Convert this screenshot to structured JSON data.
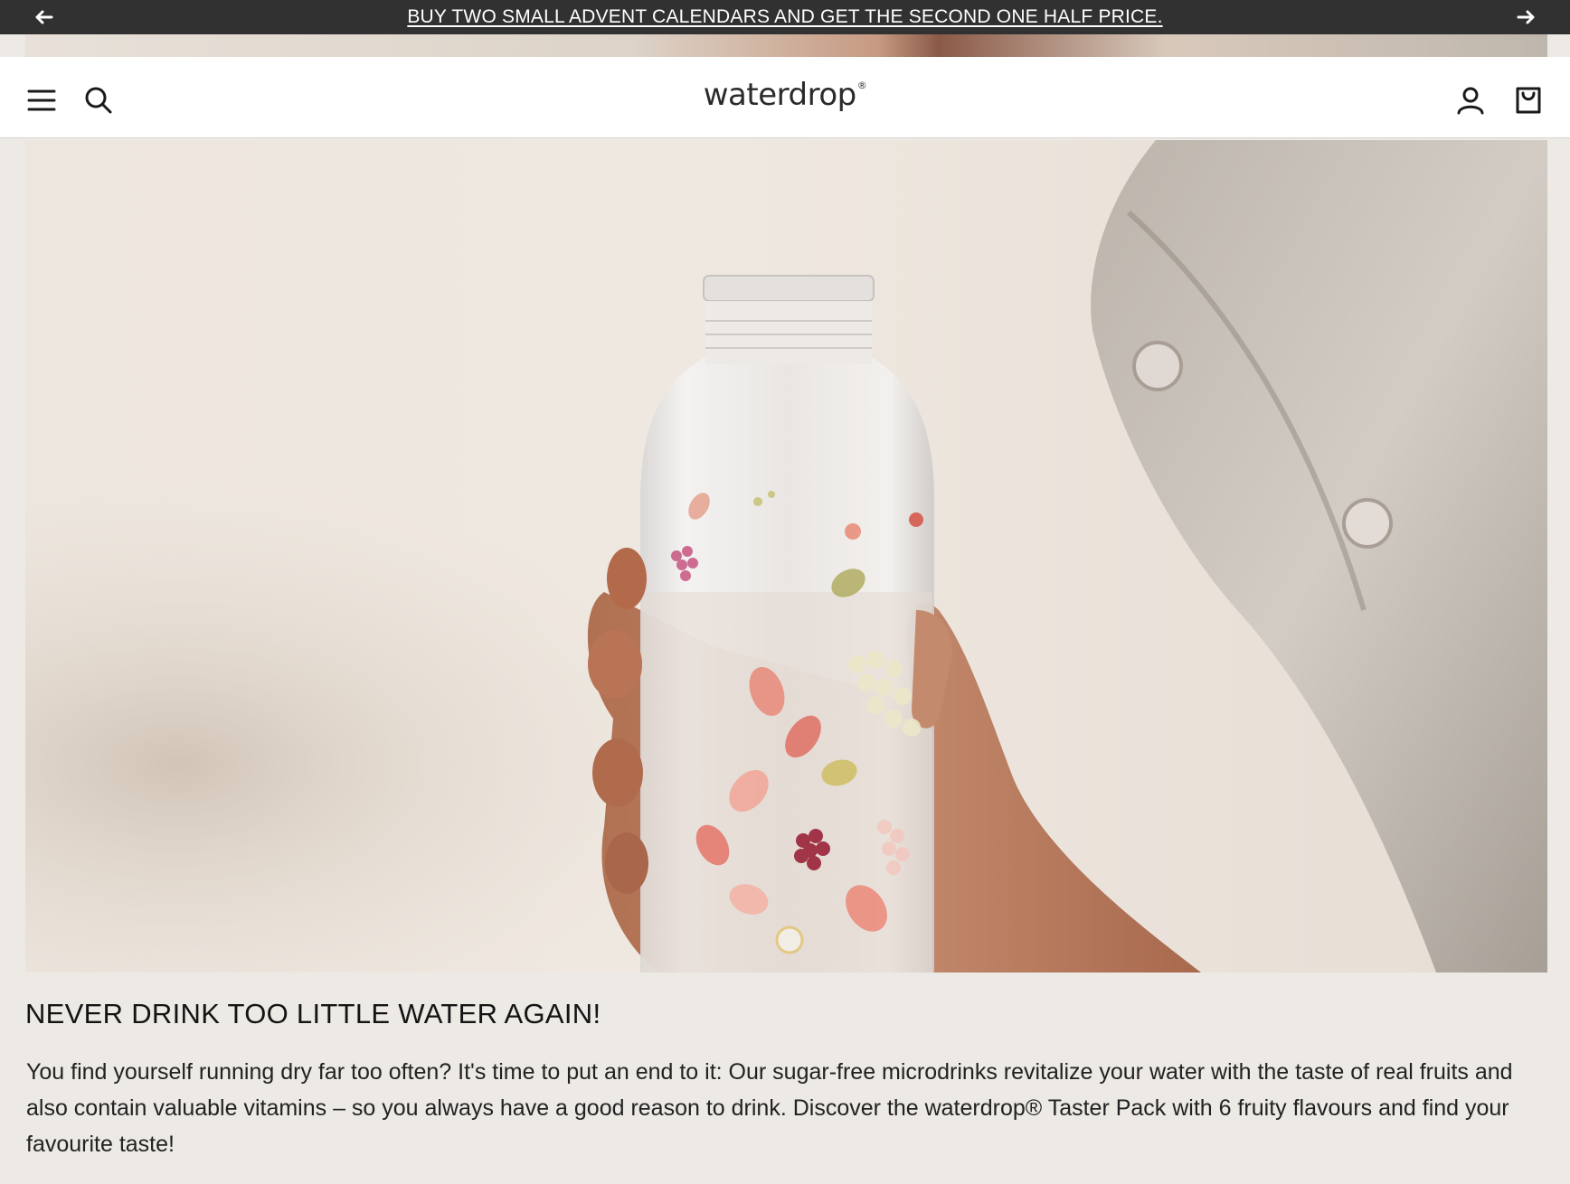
{
  "announcement": {
    "text": "BUY TWO SMALL ADVENT CALENDARS AND GET THE SECOND ONE HALF PRICE.",
    "prev_icon": "arrow-left-icon",
    "next_icon": "arrow-right-icon"
  },
  "header": {
    "logo_text": "waterdrop",
    "logo_mark": "®",
    "icons": [
      "menu-icon",
      "search-icon",
      "account-icon",
      "cart-icon"
    ]
  },
  "content": {
    "headline": "NEVER DRINK TOO LITTLE WATER AGAIN!",
    "body": "You find yourself running dry far too often? It's time to put an end to it: Our sugar-free microdrinks revitalize your water with the taste of real fruits and also contain valuable vitamins – so you always have a good reason to drink. Discover the waterdrop® Taster Pack with 6 fruity flavours and find your favourite taste!"
  },
  "colors": {
    "announcement_bg": "#313131",
    "page_bg": "#ede9e4",
    "header_bg": "#ffffff",
    "text": "#1f1f1f"
  }
}
